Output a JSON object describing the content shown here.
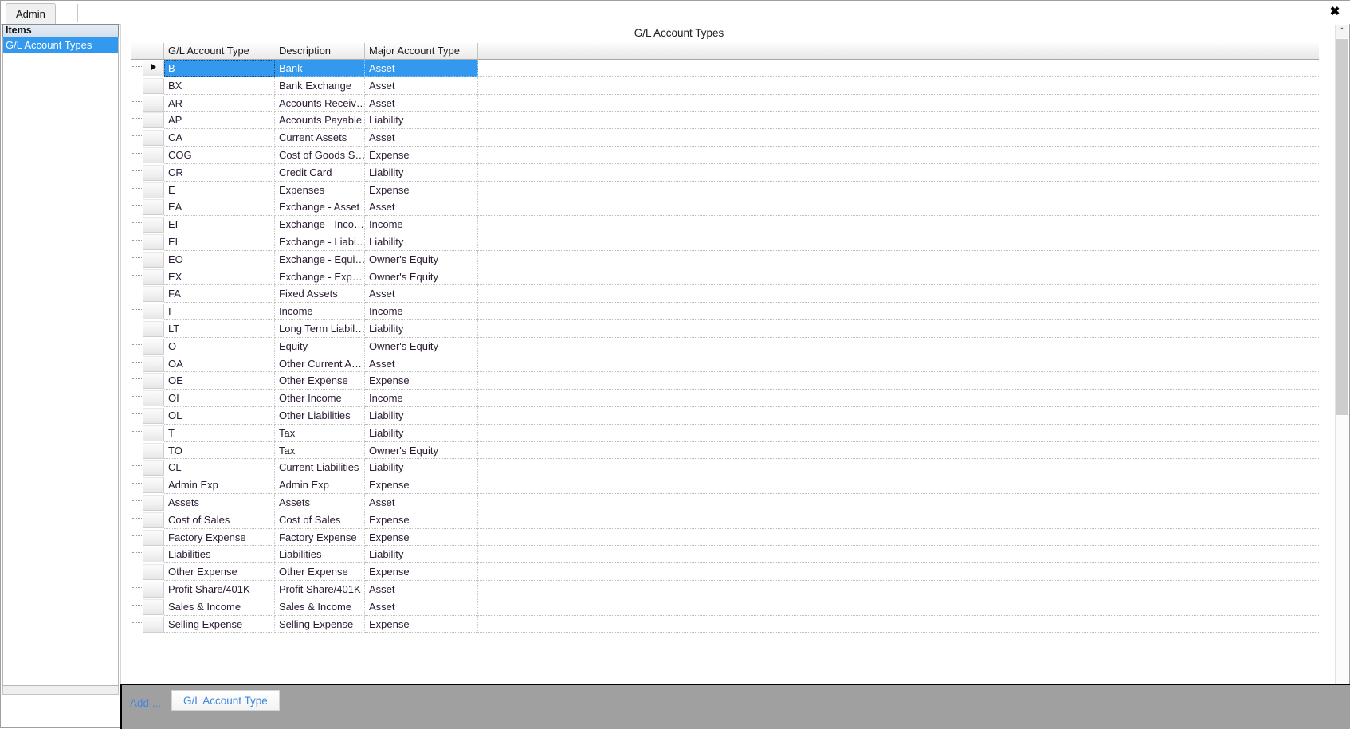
{
  "window": {
    "close_label": "✖"
  },
  "tabstrip": {
    "tabs": [
      {
        "label": "Admin"
      }
    ]
  },
  "sidebar": {
    "header": "Items",
    "items": [
      {
        "label": "G/L Account Types",
        "selected": true
      }
    ]
  },
  "content": {
    "title": "G/L Account Types"
  },
  "grid": {
    "columns": [
      {
        "key": "account_type",
        "label": "G/L Account Type"
      },
      {
        "key": "description",
        "label": "Description"
      },
      {
        "key": "major_type",
        "label": "Major Account Type"
      }
    ],
    "rows": [
      {
        "account_type": "B",
        "description": "Bank",
        "major_type": "Asset",
        "selected": true
      },
      {
        "account_type": "BX",
        "description": "Bank Exchange",
        "major_type": "Asset"
      },
      {
        "account_type": "AR",
        "description": "Accounts Receiv…",
        "major_type": "Asset"
      },
      {
        "account_type": "AP",
        "description": "Accounts Payable",
        "major_type": "Liability"
      },
      {
        "account_type": "CA",
        "description": "Current Assets",
        "major_type": "Asset"
      },
      {
        "account_type": "COG",
        "description": "Cost of Goods S…",
        "major_type": "Expense"
      },
      {
        "account_type": "CR",
        "description": "Credit Card",
        "major_type": "Liability"
      },
      {
        "account_type": "E",
        "description": "Expenses",
        "major_type": "Expense"
      },
      {
        "account_type": "EA",
        "description": "Exchange - Asset",
        "major_type": "Asset"
      },
      {
        "account_type": "EI",
        "description": "Exchange - Inco…",
        "major_type": "Income"
      },
      {
        "account_type": "EL",
        "description": "Exchange - Liabi…",
        "major_type": "Liability"
      },
      {
        "account_type": "EO",
        "description": "Exchange -  Equi…",
        "major_type": "Owner's Equity"
      },
      {
        "account_type": "EX",
        "description": "Exchange - Exp…",
        "major_type": "Owner's Equity"
      },
      {
        "account_type": "FA",
        "description": "Fixed Assets",
        "major_type": "Asset"
      },
      {
        "account_type": "I",
        "description": "Income",
        "major_type": "Income"
      },
      {
        "account_type": "LT",
        "description": "Long Term Liabil…",
        "major_type": "Liability"
      },
      {
        "account_type": "O",
        "description": "Equity",
        "major_type": "Owner's Equity"
      },
      {
        "account_type": "OA",
        "description": "Other Current A…",
        "major_type": "Asset"
      },
      {
        "account_type": "OE",
        "description": "Other Expense",
        "major_type": "Expense"
      },
      {
        "account_type": "OI",
        "description": "Other Income",
        "major_type": "Income"
      },
      {
        "account_type": "OL",
        "description": "Other Liabilities",
        "major_type": "Liability"
      },
      {
        "account_type": "T",
        "description": "Tax",
        "major_type": "Liability"
      },
      {
        "account_type": "TO",
        "description": "Tax",
        "major_type": "Owner's Equity"
      },
      {
        "account_type": "CL",
        "description": "Current Liabilities",
        "major_type": "Liability"
      },
      {
        "account_type": "Admin Exp",
        "description": "Admin Exp",
        "major_type": "Expense"
      },
      {
        "account_type": "Assets",
        "description": "Assets",
        "major_type": "Asset"
      },
      {
        "account_type": "Cost of Sales",
        "description": "Cost of Sales",
        "major_type": "Expense"
      },
      {
        "account_type": "Factory Expense",
        "description": "Factory Expense",
        "major_type": "Expense"
      },
      {
        "account_type": "Liabilities",
        "description": "Liabilities",
        "major_type": "Liability"
      },
      {
        "account_type": "Other Expense",
        "description": "Other Expense",
        "major_type": "Expense"
      },
      {
        "account_type": "Profit Share/401K",
        "description": "Profit Share/401K",
        "major_type": "Asset"
      },
      {
        "account_type": "Sales & Income",
        "description": "Sales & Income",
        "major_type": "Asset"
      },
      {
        "account_type": "Selling Expense",
        "description": "Selling Expense",
        "major_type": "Expense"
      }
    ]
  },
  "scrollbar": {
    "up_glyph": "⌃",
    "down_glyph": "⌄"
  },
  "actionbar": {
    "add_label": "Add ...",
    "entity_button": "G/L Account Type"
  },
  "colors": {
    "selection_blue": "#3399ee",
    "link_blue": "#4a86d8",
    "actionbar_gray": "#a0a0a0"
  }
}
